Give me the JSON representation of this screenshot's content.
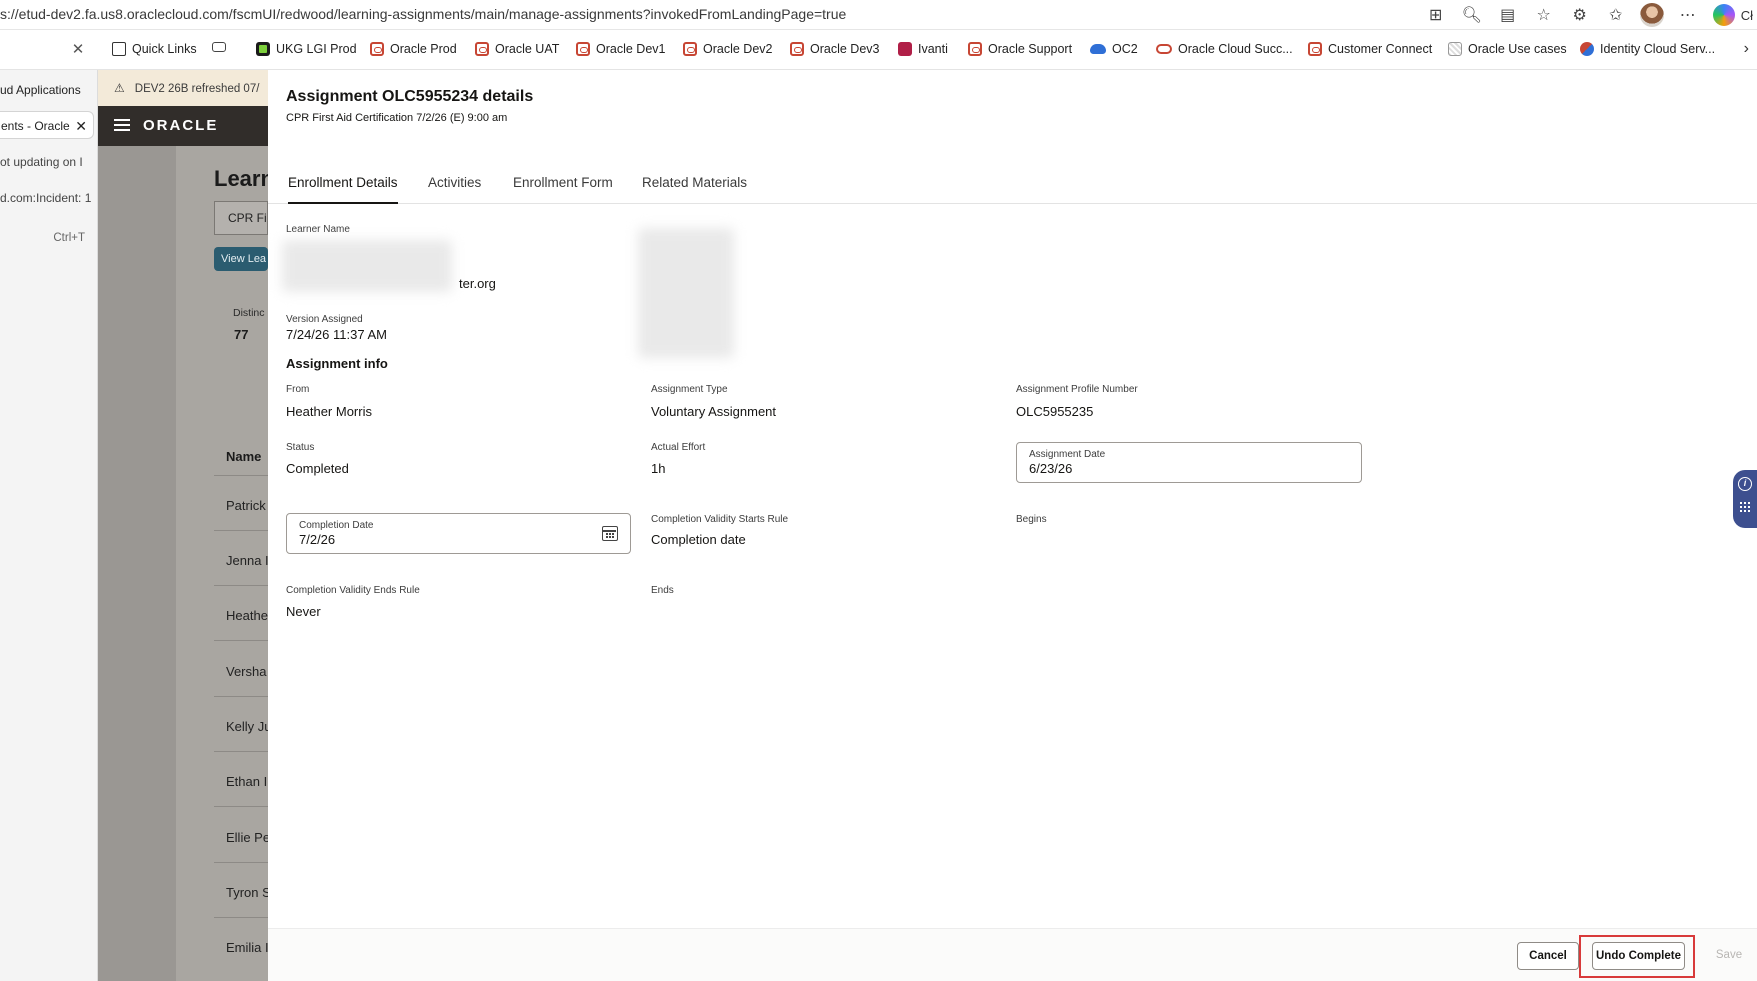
{
  "browser": {
    "url": "s://etud-dev2.fa.us8.oraclecloud.com/fscmUI/redwood/learning-assignments/main/manage-assignments?invokedFromLandingPage=true",
    "toolbar_icons": [
      "apps-icon",
      "zoom-icon",
      "reading-view-icon",
      "favorite-star-icon",
      "extensions-icon",
      "favorites-icon",
      "profile-avatar",
      "more-icon",
      "copilot-icon"
    ],
    "copilot_label": "Cł",
    "bookmarks": [
      {
        "label": "Quick Links",
        "icon": "quick-links-icon"
      },
      {
        "label": "",
        "icon": "tab-icon"
      },
      {
        "label": "UKG LGI Prod",
        "icon": "ukg-icon"
      },
      {
        "label": "Oracle Prod",
        "icon": "oracle-icon"
      },
      {
        "label": "Oracle UAT",
        "icon": "oracle-icon"
      },
      {
        "label": "Oracle Dev1",
        "icon": "oracle-icon"
      },
      {
        "label": "Oracle Dev2",
        "icon": "oracle-icon"
      },
      {
        "label": "Oracle Dev3",
        "icon": "oracle-icon"
      },
      {
        "label": "Ivanti",
        "icon": "ivanti-icon"
      },
      {
        "label": "Oracle Support",
        "icon": "oracle-icon"
      },
      {
        "label": "OC2",
        "icon": "cloud-icon"
      },
      {
        "label": "Oracle Cloud Succ...",
        "icon": "oracle-ring-icon"
      },
      {
        "label": "Customer Connect",
        "icon": "oracle-icon"
      },
      {
        "label": "Oracle Use cases",
        "icon": "image-icon"
      },
      {
        "label": "Identity Cloud Serv...",
        "icon": "identity-icon"
      }
    ],
    "side_panel": [
      {
        "label": "ud Applications"
      },
      {
        "label": "ents - Oracle"
      },
      {
        "label": "ot updating on I"
      },
      {
        "label": "d.com:Incident: 1"
      },
      {
        "label": "Ctrl+T"
      }
    ]
  },
  "background_page": {
    "banner": "DEV2 26B refreshed 07/",
    "logo": "ORACLE",
    "title": "Learn",
    "search_value": "CPR Fi",
    "button": "View Lea",
    "distinct_label": "Distinc",
    "distinct_count": "77",
    "name_header": "Name",
    "rows": [
      "Patrick",
      "Jenna I",
      "Heathe",
      "Versha",
      "Kelly Ju",
      "Ethan I",
      "Ellie Pe",
      "Tyron S",
      "Emilia I"
    ]
  },
  "drawer": {
    "title": "Assignment OLC5955234 details",
    "subtitle": "CPR First Aid Certification 7/2/26 (E) 9:00 am",
    "tabs": [
      "Enrollment Details",
      "Activities",
      "Enrollment Form",
      "Related Materials"
    ],
    "learner": {
      "label": "Learner Name",
      "email_suffix": "ter.org"
    },
    "version": {
      "label": "Version Assigned",
      "value": "7/24/26 11:37 AM"
    },
    "section_title": "Assignment info",
    "fields": {
      "from": {
        "label": "From",
        "value": "Heather Morris"
      },
      "assignment_type": {
        "label": "Assignment Type",
        "value": "Voluntary Assignment"
      },
      "profile_number": {
        "label": "Assignment Profile Number",
        "value": "OLC5955235"
      },
      "status": {
        "label": "Status",
        "value": "Completed"
      },
      "actual_effort": {
        "label": "Actual Effort",
        "value": "1h"
      },
      "assignment_date": {
        "label": "Assignment Date",
        "value": "6/23/26"
      },
      "completion_date": {
        "label": "Completion Date",
        "value": "7/2/26"
      },
      "validity_starts": {
        "label": "Completion Validity Starts Rule",
        "value": "Completion date"
      },
      "begins": {
        "label": "Begins",
        "value": ""
      },
      "validity_ends": {
        "label": "Completion Validity Ends Rule",
        "value": "Never"
      },
      "ends": {
        "label": "Ends",
        "value": ""
      }
    },
    "footer": {
      "cancel": "Cancel",
      "undo_complete": "Undo Complete",
      "save": "Save"
    }
  },
  "colors": {
    "oracle_header": "#312d2a",
    "highlight": "#d83a3a",
    "help_widget": "#3d4f8f"
  }
}
